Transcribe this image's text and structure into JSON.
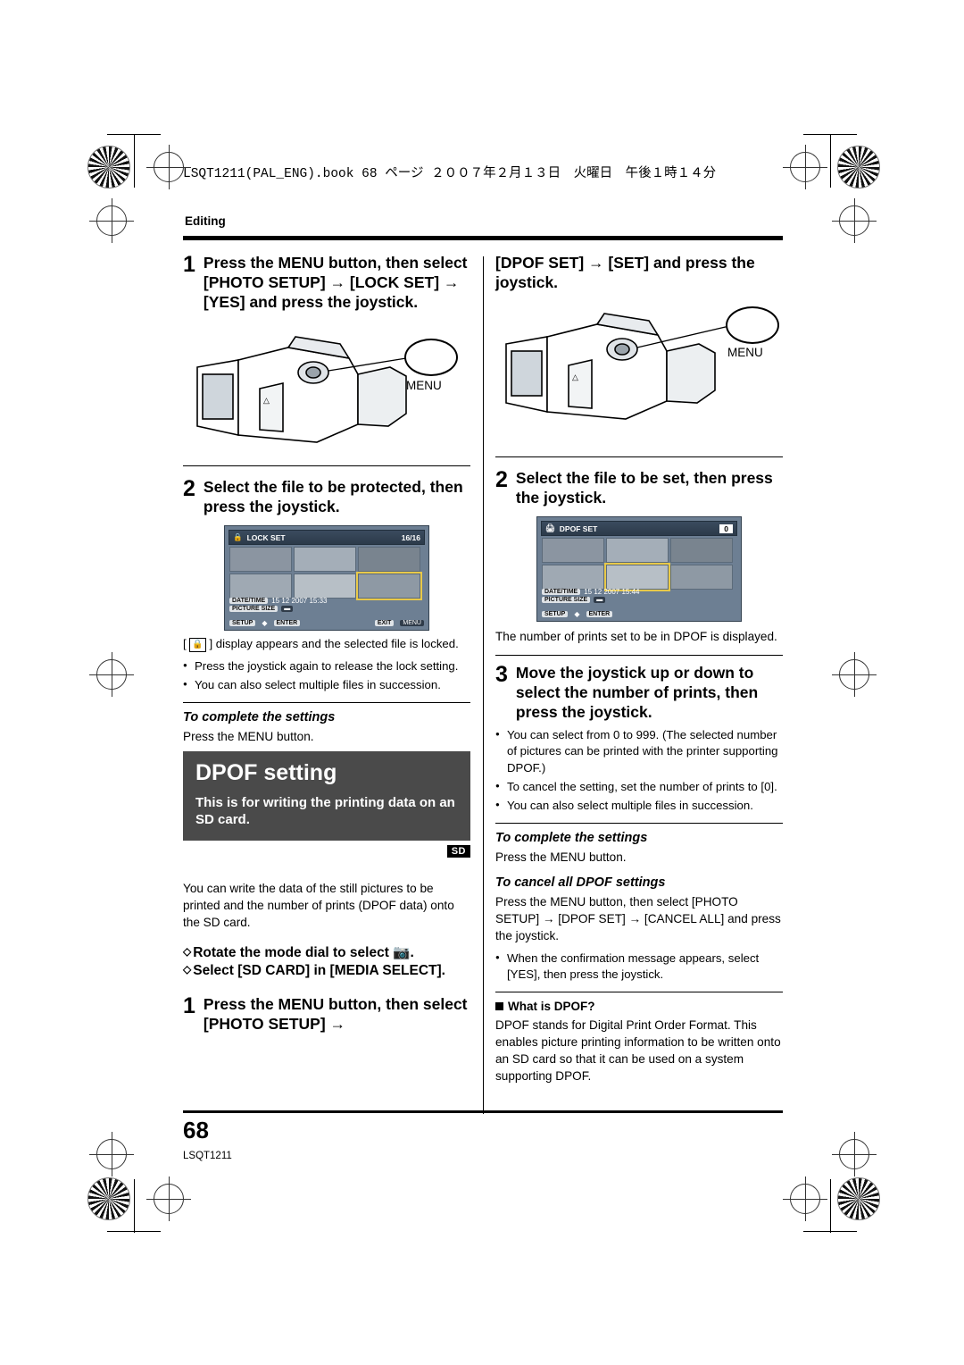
{
  "header": {
    "fileline": "LSQT1211(PAL_ENG).book  68 ページ  ２００７年２月１３日　火曜日　午後１時１４分",
    "chapter": "Editing"
  },
  "left": {
    "step1_num": "1",
    "step1_text": "Press the MENU button, then select [PHOTO SETUP] → [LOCK SET] → [YES] and press the joystick.",
    "menu_label": "MENU",
    "step2_num": "2",
    "step2_text": "Select the file to be protected, then press the joystick.",
    "lcd": {
      "title": "LOCK SET",
      "count": "16/16",
      "datetime_label": "DATE/TIME",
      "datetime_value": "15 12 2007  15:33",
      "picturesize_label": "PICTURE SIZE",
      "setup_label": "SETUP",
      "enter_label": "ENTER",
      "exit_label": "EXIT",
      "exit_key": "MENU"
    },
    "after_lcd_1": "[",
    "after_lcd_2": "] display appears and the selected file is locked.",
    "bullets": [
      "Press the joystick again to release the lock setting.",
      "You can also select multiple files in succession."
    ],
    "complete_head": "To complete the settings",
    "complete_text": "Press the MENU button.",
    "banner_title": "DPOF setting",
    "banner_text": "This is for writing the printing data on an SD card.",
    "sd_badge": "SD",
    "para": "You can write the data of the still pictures to be printed and the number of prints (DPOF data) onto the SD card.",
    "diamond1": "Rotate the mode dial to select",
    "diamond2": "Select [SD CARD] in [MEDIA SELECT].",
    "step1b_num": "1",
    "step1b_text": "Press the MENU button, then select [PHOTO SETUP] →"
  },
  "right": {
    "cont_head": "[DPOF SET] → [SET] and press the joystick.",
    "menu_label": "MENU",
    "step2_num": "2",
    "step2_text": "Select the file to be set, then press the joystick.",
    "lcd": {
      "title": "DPOF SET",
      "count": "0",
      "datetime_label": "DATE/TIME",
      "datetime_value": "15 12 2007  15:44",
      "picturesize_label": "PICTURE SIZE",
      "setup_label": "SETUP",
      "enter_label": "ENTER"
    },
    "after_lcd": "The number of prints set to be in DPOF is displayed.",
    "step3_num": "3",
    "step3_text": "Move the joystick up or down to select the number of prints, then press the joystick.",
    "bullets": [
      "You can select from 0 to 999. (The selected number of pictures can be printed with the printer supporting DPOF.)",
      "To cancel the setting, set the number of prints to [0].",
      "You can also select multiple files in succession."
    ],
    "complete_head": "To complete the settings",
    "complete_text": "Press the MENU button.",
    "cancel_head": "To cancel all DPOF settings",
    "cancel_text": "Press the MENU button, then select [PHOTO SETUP] → [DPOF SET] → [CANCEL ALL] and press the joystick.",
    "cancel_bullet": "When the confirmation message appears, select [YES], then press the joystick.",
    "what_head": "What is DPOF?",
    "what_text": "DPOF stands for Digital Print Order Format. This enables picture printing information to be written onto an SD card so that it can be used on a system supporting DPOF."
  },
  "footer": {
    "page_number": "68",
    "code": "LSQT1211"
  }
}
